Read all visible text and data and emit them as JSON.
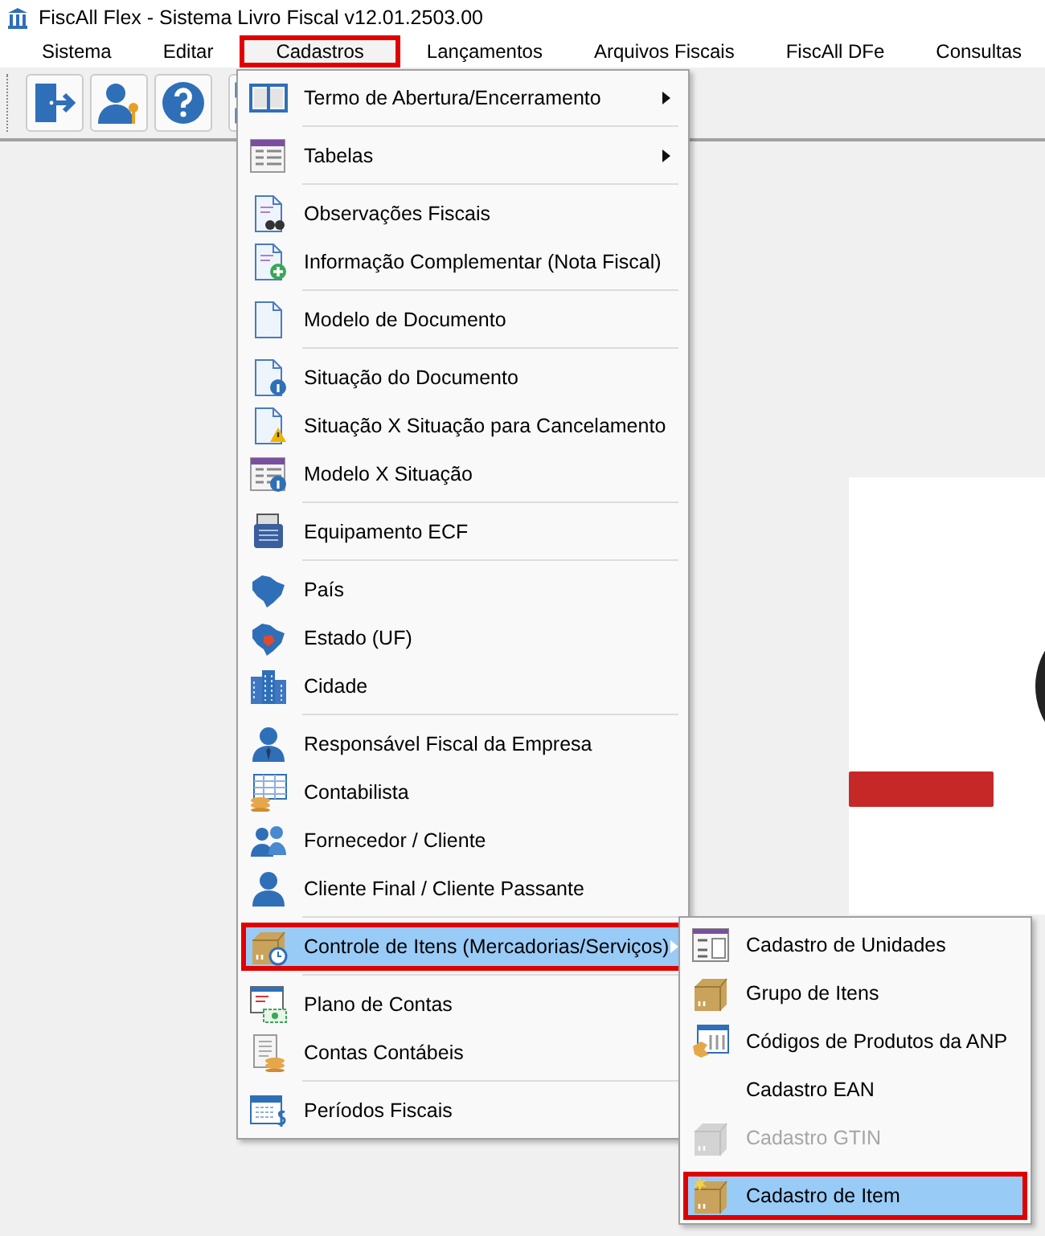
{
  "window": {
    "title": "FiscAll Flex - Sistema Livro Fiscal v12.01.2503.00"
  },
  "menu_bar": [
    {
      "label": "Sistema",
      "selected": false,
      "highlighted": false
    },
    {
      "label": "Editar",
      "selected": false,
      "highlighted": false
    },
    {
      "label": "Cadastros",
      "selected": true,
      "highlighted": true
    },
    {
      "label": "Lançamentos",
      "selected": false,
      "highlighted": false
    },
    {
      "label": "Arquivos Fiscais",
      "selected": false,
      "highlighted": false
    },
    {
      "label": "FiscAll DFe",
      "selected": false,
      "highlighted": false
    },
    {
      "label": "Consultas",
      "selected": false,
      "highlighted": false
    }
  ],
  "dropdown": {
    "groups": [
      {
        "items": [
          {
            "label": "Termo de Abertura/Encerramento",
            "has_submenu": true,
            "selected": false,
            "highlighted": false
          }
        ]
      },
      {
        "items": [
          {
            "label": "Tabelas",
            "has_submenu": true,
            "selected": false,
            "highlighted": false
          }
        ]
      },
      {
        "items": [
          {
            "label": "Observações Fiscais",
            "has_submenu": false,
            "selected": false,
            "highlighted": false
          },
          {
            "label": "Informação Complementar (Nota Fiscal)",
            "has_submenu": false,
            "selected": false,
            "highlighted": false
          }
        ]
      },
      {
        "items": [
          {
            "label": "Modelo de Documento",
            "has_submenu": false,
            "selected": false,
            "highlighted": false
          }
        ]
      },
      {
        "items": [
          {
            "label": "Situação do Documento",
            "has_submenu": false,
            "selected": false,
            "highlighted": false
          },
          {
            "label": "Situação X Situação para Cancelamento",
            "has_submenu": false,
            "selected": false,
            "highlighted": false
          },
          {
            "label": "Modelo X Situação",
            "has_submenu": false,
            "selected": false,
            "highlighted": false
          }
        ]
      },
      {
        "items": [
          {
            "label": "Equipamento ECF",
            "has_submenu": false,
            "selected": false,
            "highlighted": false
          }
        ]
      },
      {
        "items": [
          {
            "label": "País",
            "has_submenu": false,
            "selected": false,
            "highlighted": false
          },
          {
            "label": "Estado (UF)",
            "has_submenu": false,
            "selected": false,
            "highlighted": false
          },
          {
            "label": "Cidade",
            "has_submenu": false,
            "selected": false,
            "highlighted": false
          }
        ]
      },
      {
        "items": [
          {
            "label": "Responsável Fiscal da Empresa",
            "has_submenu": false,
            "selected": false,
            "highlighted": false
          },
          {
            "label": "Contabilista",
            "has_submenu": false,
            "selected": false,
            "highlighted": false
          },
          {
            "label": "Fornecedor / Cliente",
            "has_submenu": false,
            "selected": false,
            "highlighted": false
          },
          {
            "label": "Cliente Final / Cliente Passante",
            "has_submenu": false,
            "selected": false,
            "highlighted": false
          }
        ]
      },
      {
        "items": [
          {
            "label": "Controle de Itens (Mercadorias/Serviços)",
            "has_submenu": true,
            "selected": true,
            "highlighted": true
          }
        ]
      },
      {
        "items": [
          {
            "label": "Plano de Contas",
            "has_submenu": false,
            "selected": false,
            "highlighted": false
          },
          {
            "label": "Contas Contábeis",
            "has_submenu": false,
            "selected": false,
            "highlighted": false
          }
        ]
      },
      {
        "items": [
          {
            "label": "Períodos Fiscais",
            "has_submenu": false,
            "selected": false,
            "highlighted": false
          }
        ]
      }
    ]
  },
  "submenu": {
    "groups": [
      {
        "items": [
          {
            "label": "Cadastro de Unidades",
            "disabled": false,
            "selected": false,
            "highlighted": false
          },
          {
            "label": "Grupo de Itens",
            "disabled": false,
            "selected": false,
            "highlighted": false
          },
          {
            "label": "Códigos de Produtos da ANP",
            "disabled": false,
            "selected": false,
            "highlighted": false
          },
          {
            "label": "Cadastro EAN",
            "disabled": false,
            "selected": false,
            "highlighted": false
          },
          {
            "label": "Cadastro GTIN",
            "disabled": true,
            "selected": false,
            "highlighted": false
          }
        ]
      },
      {
        "items": [
          {
            "label": "Cadastro de Item",
            "disabled": false,
            "selected": true,
            "highlighted": true
          }
        ]
      }
    ]
  }
}
